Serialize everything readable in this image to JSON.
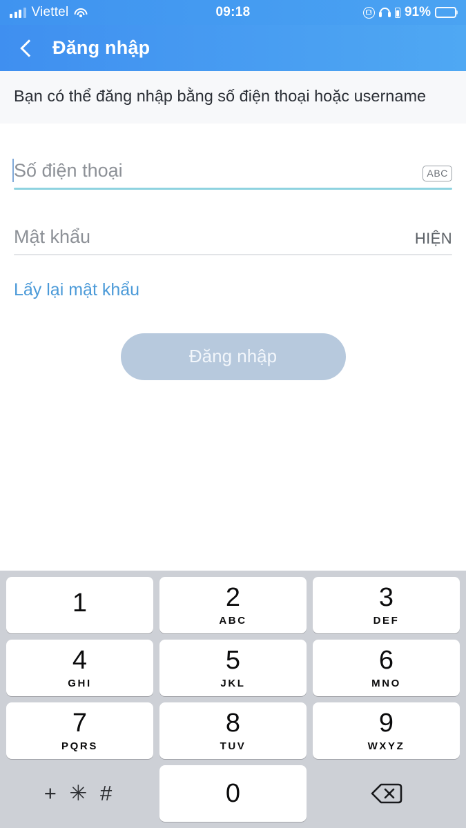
{
  "status_bar": {
    "carrier": "Viettel",
    "time": "09:18",
    "battery_percent": "91%",
    "signal_bars_filled": 3,
    "icons": {
      "signal": "signal-bars-icon",
      "wifi": "wifi-icon",
      "rotation_lock": "rotation-lock-icon",
      "headphones": "headphones-icon",
      "headphone_battery": "headphone-battery-icon",
      "battery": "battery-icon"
    }
  },
  "nav_bar": {
    "back_icon": "back-chevron-icon",
    "title": "Đăng nhập"
  },
  "description": {
    "text": "Bạn có thể đăng nhập bằng số điện thoại hoặc username"
  },
  "form": {
    "phone_field": {
      "placeholder": "Số điện thoại",
      "value": "",
      "keyboard_toggle_label": "ABC",
      "focused": true
    },
    "password_field": {
      "placeholder": "Mật khẩu",
      "value": "",
      "show_label": "HIỆN",
      "focused": false
    },
    "forgot_password_label": "Lấy lại mật khẩu",
    "login_button_label": "Đăng nhập",
    "login_button_enabled": false
  },
  "keypad": {
    "rows": [
      [
        {
          "digit": "1",
          "letters": ""
        },
        {
          "digit": "2",
          "letters": "ABC"
        },
        {
          "digit": "3",
          "letters": "DEF"
        }
      ],
      [
        {
          "digit": "4",
          "letters": "GHI"
        },
        {
          "digit": "5",
          "letters": "JKL"
        },
        {
          "digit": "6",
          "letters": "MNO"
        }
      ],
      [
        {
          "digit": "7",
          "letters": "PQRS"
        },
        {
          "digit": "8",
          "letters": "TUV"
        },
        {
          "digit": "9",
          "letters": "WXYZ"
        }
      ]
    ],
    "symbols_key_label": "+ ✳ #",
    "zero_key_label": "0",
    "backspace_icon": "backspace-delete-icon"
  },
  "colors": {
    "header_blue_left": "#3f8ff0",
    "header_blue_right": "#4fa8f3",
    "accent_underline": "#8ed3e0",
    "link_blue": "#4b9ad8",
    "login_button_disabled": "#b7c9dd",
    "keypad_background": "#cdd0d6",
    "description_background": "#f7f8fa"
  }
}
